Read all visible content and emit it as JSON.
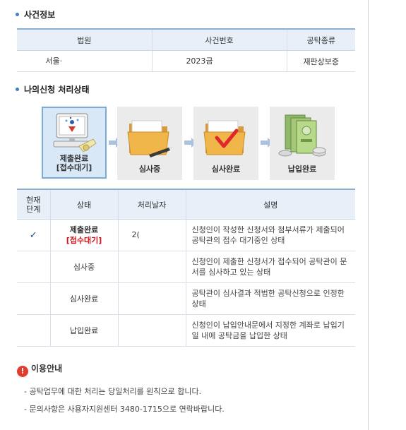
{
  "case_info": {
    "title": "사건정보",
    "headers": [
      "법원",
      "사건번호",
      "공탁종류"
    ],
    "row": {
      "court": "서울·",
      "case_no": "2023금",
      "deposit_type": "재판상보증"
    }
  },
  "progress": {
    "title": "나의신청 처리상태",
    "steps": [
      {
        "label": "제출완료",
        "sub": "[접수대기]",
        "icon": "computer-document-icon"
      },
      {
        "label": "심사중",
        "sub": "",
        "icon": "folder-pencil-icon"
      },
      {
        "label": "심사완료",
        "sub": "",
        "icon": "folder-check-icon"
      },
      {
        "label": "납입완료",
        "sub": "",
        "icon": "money-bills-icon"
      }
    ]
  },
  "status_table": {
    "headers": {
      "current": "현재\n단계",
      "state": "상태",
      "date": "처리날자",
      "desc": "설명"
    },
    "rows": [
      {
        "check": "✓",
        "state": "제출완료",
        "state_sub": "[접수대기]",
        "date": "2(",
        "desc": "신청인이 작성한 신청서와 첨부서류가 제출되어 공탁관의 접수 대기중인 상태"
      },
      {
        "check": "",
        "state": "심사중",
        "state_sub": "",
        "date": "",
        "desc": "신청인이 제출한 신청서가 접수되어 공탁관이 문서를 심사하고 있는 상태"
      },
      {
        "check": "",
        "state": "심사완료",
        "state_sub": "",
        "date": "",
        "desc": "공탁관이 심사결과 적법한 공탁신청으로 인정한 상태"
      },
      {
        "check": "",
        "state": "납입완료",
        "state_sub": "",
        "date": "",
        "desc": "신청인이 납입안내문에서 지정한 계좌로 납입기일 내에 공탁금을 납입한 상태"
      }
    ]
  },
  "notice": {
    "icon_text": "!",
    "title": "이용안내",
    "lines": [
      "- 공탁업무에 대한 처리는 당일처리를 원칙으로 합니다.",
      "- 문의사항은 사용자지원센터 3480-1715으로 연락바랍니다."
    ]
  }
}
